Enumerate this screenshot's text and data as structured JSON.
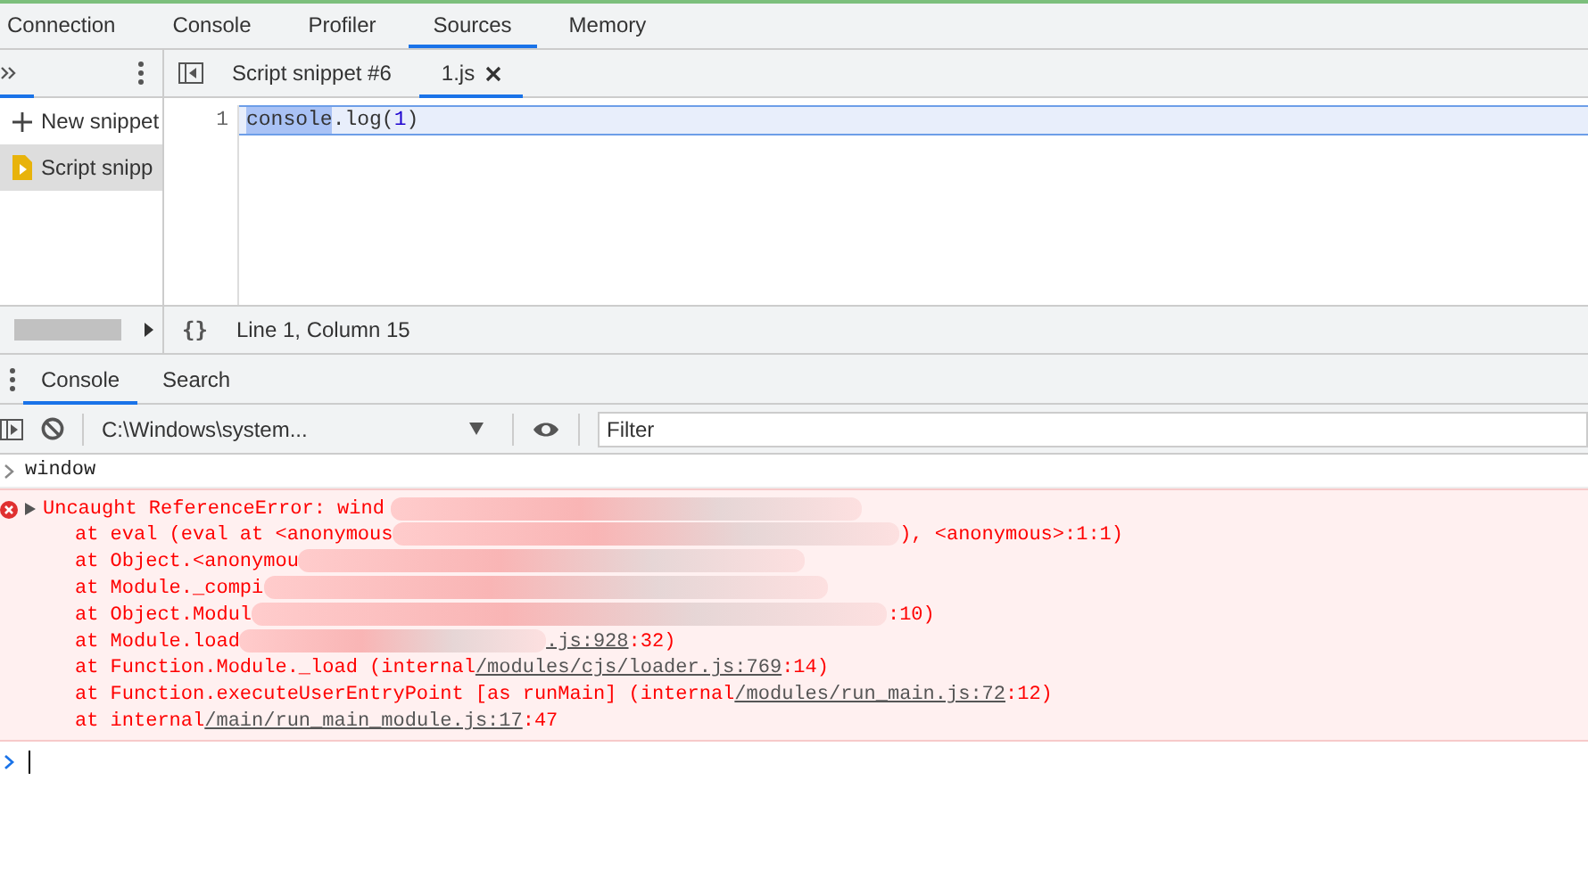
{
  "main_tabs": [
    {
      "label": "Connection",
      "selected": false
    },
    {
      "label": "Console",
      "selected": false
    },
    {
      "label": "Profiler",
      "selected": false
    },
    {
      "label": "Sources",
      "selected": true
    },
    {
      "label": "Memory",
      "selected": false
    }
  ],
  "navigator": {
    "items": [
      {
        "kind": "action",
        "label": "New snippet",
        "selected": false
      },
      {
        "kind": "file",
        "label": "Script snipp",
        "selected": true
      }
    ]
  },
  "editor": {
    "tabs": [
      {
        "label": "Script snippet #6",
        "selected": false,
        "closable": false
      },
      {
        "label": "1.js",
        "selected": true,
        "closable": true
      }
    ],
    "lines": [
      {
        "number": "1",
        "tokens": [
          {
            "kind": "selection",
            "text": "console"
          },
          {
            "kind": "plain",
            "text": ".log("
          },
          {
            "kind": "number",
            "text": "1"
          },
          {
            "kind": "plain",
            "text": ")"
          }
        ]
      }
    ],
    "pretty_print": "{}",
    "status": "Line 1, Column 15"
  },
  "drawer_tabs": [
    {
      "label": "Console",
      "selected": true
    },
    {
      "label": "Search",
      "selected": false
    }
  ],
  "console": {
    "context": "C:\\Windows\\system...",
    "filter_placeholder": "Filter",
    "input": "window",
    "error": {
      "message": "Uncaught ReferenceError: wind",
      "frames": [
        {
          "segments": [
            {
              "kind": "text",
              "text": "at eval (eval at <anonymous"
            },
            {
              "kind": "redacted"
            },
            {
              "kind": "text",
              "text": "), <anonymous>:1:1)"
            }
          ]
        },
        {
          "segments": [
            {
              "kind": "text",
              "text": "at Object.<anonymou"
            },
            {
              "kind": "redacted"
            }
          ]
        },
        {
          "segments": [
            {
              "kind": "text",
              "text": "at Module._compi"
            },
            {
              "kind": "redacted"
            }
          ]
        },
        {
          "segments": [
            {
              "kind": "text",
              "text": "at Object.Modul"
            },
            {
              "kind": "redacted"
            },
            {
              "kind": "text",
              "text": ":10)"
            }
          ]
        },
        {
          "segments": [
            {
              "kind": "text",
              "text": "at Module.load"
            },
            {
              "kind": "redacted"
            },
            {
              "kind": "link",
              "text": ".js:928"
            },
            {
              "kind": "text",
              "text": ":32)"
            }
          ]
        },
        {
          "segments": [
            {
              "kind": "text",
              "text": "at Function.Module._load (internal"
            },
            {
              "kind": "link",
              "text": "/modules/cjs/loader.js:769"
            },
            {
              "kind": "text",
              "text": ":14)"
            }
          ]
        },
        {
          "segments": [
            {
              "kind": "text",
              "text": "at Function.executeUserEntryPoint [as runMain] (internal"
            },
            {
              "kind": "link",
              "text": "/modules/run_main.js:72"
            },
            {
              "kind": "text",
              "text": ":12)"
            }
          ]
        },
        {
          "segments": [
            {
              "kind": "text",
              "text": "at internal"
            },
            {
              "kind": "link",
              "text": "/main/run_main_module.js:17"
            },
            {
              "kind": "text",
              "text": ":47"
            }
          ]
        }
      ]
    }
  }
}
